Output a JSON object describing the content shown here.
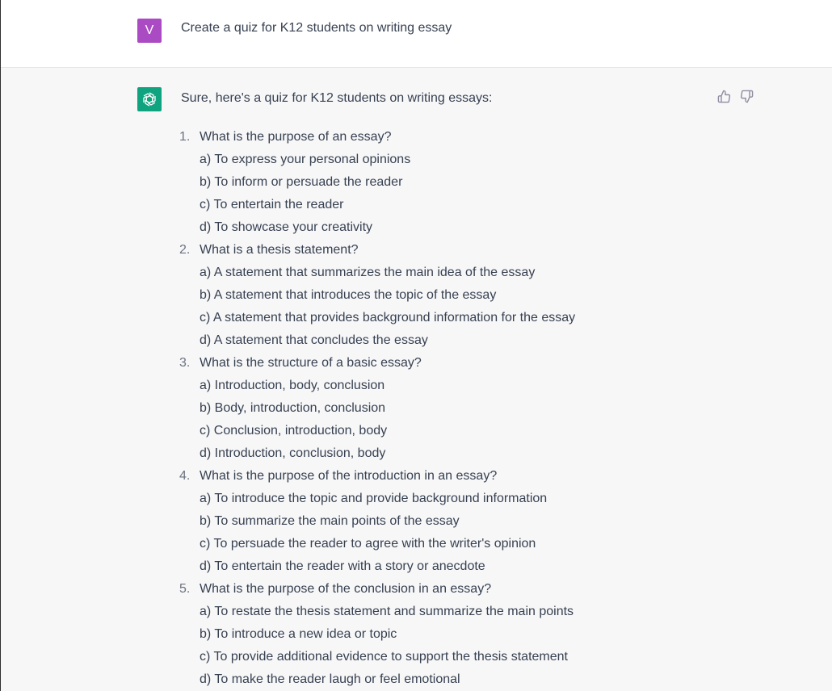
{
  "user_message": {
    "avatar_letter": "V",
    "text": "Create a quiz for K12 students on writing essay"
  },
  "assistant_message": {
    "intro": "Sure, here's a quiz for K12 students on writing essays:",
    "questions": [
      {
        "number": "1.",
        "text": "What is the purpose of an essay?",
        "options": [
          "a) To express your personal opinions",
          "b) To inform or persuade the reader",
          "c) To entertain the reader",
          "d) To showcase your creativity"
        ]
      },
      {
        "number": "2.",
        "text": "What is a thesis statement?",
        "options": [
          "a) A statement that summarizes the main idea of the essay",
          "b) A statement that introduces the topic of the essay",
          "c) A statement that provides background information for the essay",
          "d) A statement that concludes the essay"
        ]
      },
      {
        "number": "3.",
        "text": "What is the structure of a basic essay?",
        "options": [
          "a) Introduction, body, conclusion",
          "b) Body, introduction, conclusion",
          "c) Conclusion, introduction, body",
          "d) Introduction, conclusion, body"
        ]
      },
      {
        "number": "4.",
        "text": "What is the purpose of the introduction in an essay?",
        "options": [
          "a) To introduce the topic and provide background information",
          "b) To summarize the main points of the essay",
          "c) To persuade the reader to agree with the writer's opinion",
          "d) To entertain the reader with a story or anecdote"
        ]
      },
      {
        "number": "5.",
        "text": "What is the purpose of the conclusion in an essay?",
        "options": [
          "a) To restate the thesis statement and summarize the main points",
          "b) To introduce a new idea or topic",
          "c) To provide additional evidence to support the thesis statement",
          "d) To make the reader laugh or feel emotional"
        ]
      }
    ]
  },
  "icons": {
    "assistant_avatar": "openai-logo-icon",
    "like": "thumbs-up-icon",
    "dislike": "thumbs-down-icon"
  },
  "colors": {
    "user_avatar_bg": "#ab4bc3",
    "assistant_avatar_bg": "#10a37f",
    "assistant_row_bg": "#f7f7f8",
    "text": "#374151"
  }
}
